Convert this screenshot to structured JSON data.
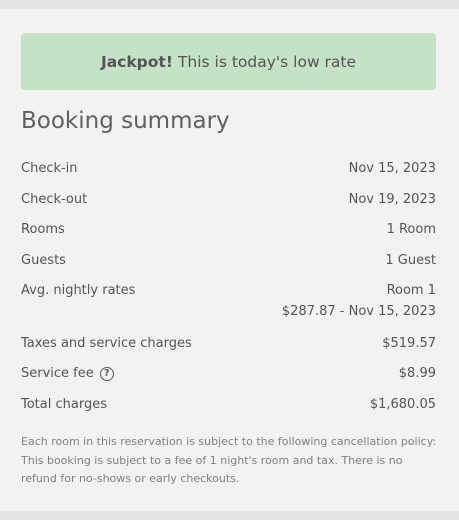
{
  "banner": {
    "strong": "Jackpot!",
    "text": "This is today's low rate"
  },
  "summary": {
    "title": "Booking summary",
    "rows": [
      {
        "label": "Check-in",
        "value": "Nov 15, 2023"
      },
      {
        "label": "Check-out",
        "value": "Nov 19, 2023"
      },
      {
        "label": "Rooms",
        "value": "1 Room"
      },
      {
        "label": "Guests",
        "value": "1 Guest"
      },
      {
        "label": "Avg. nightly rates",
        "value": "Room 1",
        "value2": "$287.87 - Nov 15, 2023"
      },
      {
        "label": "Taxes and service charges",
        "value": "$519.57"
      },
      {
        "label": "Service fee",
        "value": "$8.99",
        "help_icon": "question-circle-icon"
      },
      {
        "label": "Total charges",
        "value": "$1,680.05"
      }
    ],
    "help_glyph": "?",
    "policy": "Each room in this reservation is subject to the following cancellation policy: This booking is subject to a fee of 1 night's room and tax. There is no refund for no-shows or early checkouts."
  }
}
